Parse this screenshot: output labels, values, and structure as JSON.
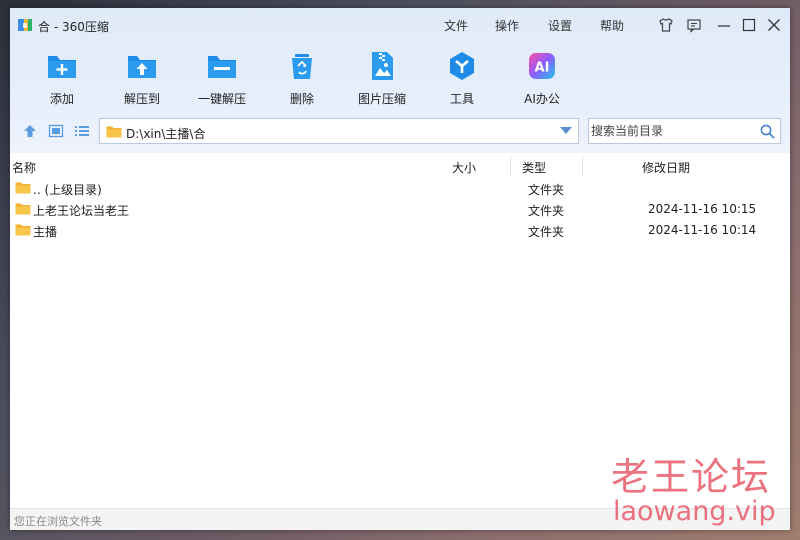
{
  "window": {
    "title": "合 - 360压缩"
  },
  "menu": [
    "文件",
    "操作",
    "设置",
    "帮助"
  ],
  "title_icons": [
    "skin-icon",
    "feedback-icon",
    "minimize-icon",
    "maximize-icon",
    "close-icon"
  ],
  "toolbar": [
    {
      "id": "add",
      "label": "添加",
      "icon": "add-folder-icon"
    },
    {
      "id": "extract-to",
      "label": "解压到",
      "icon": "extract-folder-icon"
    },
    {
      "id": "one-click-extract",
      "label": "一键解压",
      "icon": "one-click-extract-icon"
    },
    {
      "id": "delete",
      "label": "删除",
      "icon": "recycle-bin-icon"
    },
    {
      "id": "image-compress",
      "label": "图片压缩",
      "icon": "image-compress-icon"
    },
    {
      "id": "tools",
      "label": "工具",
      "icon": "tools-icon"
    },
    {
      "id": "ai-office",
      "label": "AI办公",
      "icon": "ai-icon",
      "icon_text": "AI"
    }
  ],
  "path": {
    "value": "D:\\xin\\主播\\合"
  },
  "search": {
    "placeholder": "搜索当前目录"
  },
  "columns": {
    "name": "名称",
    "size": "大小",
    "type": "类型",
    "date": "修改日期"
  },
  "files": [
    {
      "name": ".. (上级目录)",
      "type": "文件夹",
      "date": ""
    },
    {
      "name": "上老王论坛当老王",
      "type": "文件夹",
      "date": "2024-11-16 10:15"
    },
    {
      "name": "主播",
      "type": "文件夹",
      "date": "2024-11-16 10:14"
    }
  ],
  "status": {
    "text": "您正在浏览文件夹"
  },
  "watermark": {
    "cn": "老王论坛",
    "en": "laowang.vip"
  },
  "colors": {
    "accent": "#1f8be8",
    "folder": "#f7c54a",
    "watermark": "#e85a68"
  }
}
